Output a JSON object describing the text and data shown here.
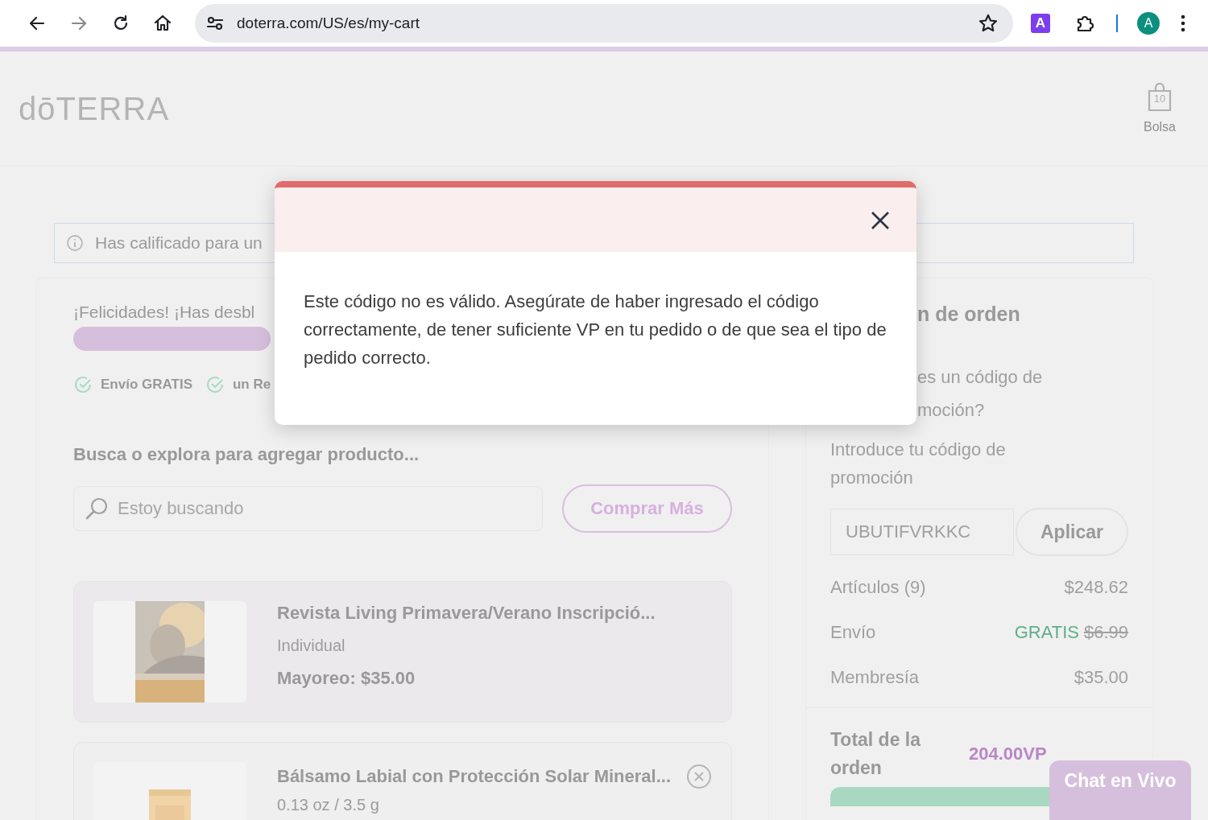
{
  "browser": {
    "url": "doterra.com/US/es/my-cart",
    "extension_letter": "A",
    "profile_letter": "A"
  },
  "header": {
    "logo": "dōTERRA",
    "bag_count": "10",
    "bag_label": "Bolsa"
  },
  "banner": {
    "text": "Has calificado para un"
  },
  "rewards": {
    "title": "¡Felicidades! ¡Has desbl",
    "level": 1,
    "perks": [
      {
        "label": "Envío GRATIS"
      },
      {
        "label": "un Re"
      }
    ]
  },
  "search": {
    "heading": "Busca o explora para agregar producto...",
    "placeholder": "Estoy buscando",
    "button": "Comprar Más"
  },
  "products": [
    {
      "title": "Revista Living Primavera/Verano Inscripció...",
      "variant": "Individual",
      "price": "Mayoreo: $35.00",
      "removable": false
    },
    {
      "title": "Bálsamo Labial con Protección Solar Mineral...",
      "variant": "0.13 oz / 3.5 g",
      "removable": true
    }
  ],
  "summary": {
    "title": "n de orden",
    "question_lines": [
      "es un código de",
      "moción?"
    ],
    "promo_label": "Introduce tu código de promoción",
    "promo_value": "UBUTIFVRKKC",
    "apply_button": "Aplicar",
    "rows": [
      {
        "label": "Artículos (9)",
        "value": "$248.62"
      },
      {
        "label": "Envío",
        "value": "GRATIS",
        "original_value": "$6.99"
      },
      {
        "label": "Membresía",
        "value": "$35.00"
      }
    ],
    "total_label": "Total de la orden",
    "total_vp": "204.00VP"
  },
  "modal": {
    "message": "Este código no es válido. Asegúrate de haber ingresado el código correctamente, de tener suficiente VP en tu pedido o de que sea el tipo de pedido correcto."
  },
  "chat": {
    "label": "Chat en Vivo"
  }
}
